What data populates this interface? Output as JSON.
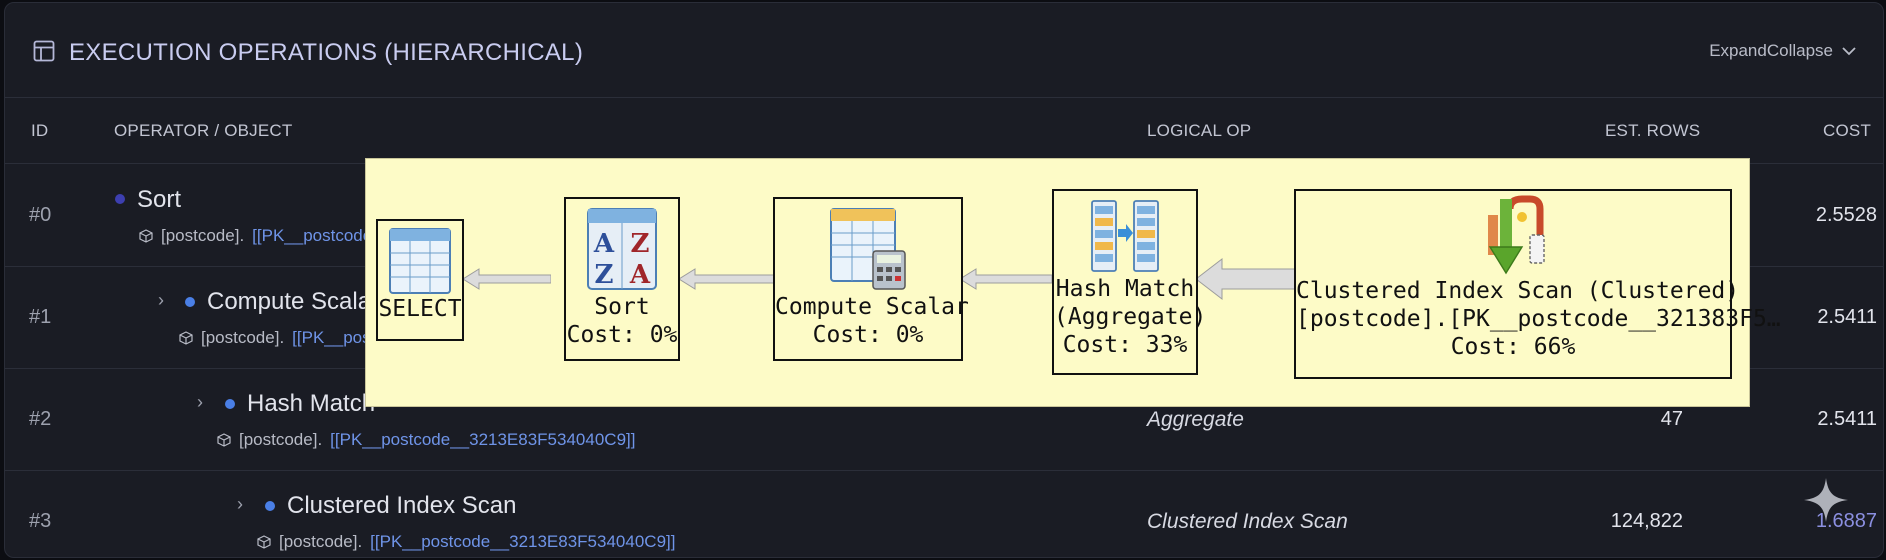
{
  "header": {
    "title": "EXECUTION OPERATIONS (HIERARCHICAL)",
    "toggle_label": "ExpandCollapse"
  },
  "columns": {
    "id": "ID",
    "operator": "OPERATOR / OBJECT",
    "logical": "LOGICAL OP",
    "rows": "EST. ROWS",
    "cost": "COST"
  },
  "rows": [
    {
      "id": "#0",
      "operator": "Sort",
      "object_prefix": "[postcode].",
      "object_link": "[[PK__postcode",
      "logical": "",
      "rows": "",
      "cost": "2.5528"
    },
    {
      "id": "#1",
      "operator": "Compute Scala",
      "object_prefix": "[postcode].",
      "object_link": "[[PK__post",
      "logical": "",
      "rows": "",
      "cost": "2.5411"
    },
    {
      "id": "#2",
      "operator": "Hash Match",
      "object_prefix": "[postcode].",
      "object_link": "[[PK__postcode__3213E83F534040C9]]",
      "logical": "Aggregate",
      "rows": "47",
      "cost": "2.5411"
    },
    {
      "id": "#3",
      "operator": "Clustered Index Scan",
      "object_prefix": "[postcode].",
      "object_link": "[[PK__postcode__3213E83F534040C9]]",
      "logical": "Clustered Index Scan",
      "rows": "124,822",
      "cost": "1.6887"
    }
  ],
  "plan": {
    "nodes": [
      {
        "lines": [
          "SELECT"
        ]
      },
      {
        "lines": [
          "Sort",
          "Cost: 0%"
        ]
      },
      {
        "lines": [
          "Compute Scalar",
          "Cost: 0%"
        ]
      },
      {
        "lines": [
          "Hash Match",
          "(Aggregate)",
          "Cost: 33%"
        ]
      },
      {
        "lines": [
          "Clustered Index Scan (Clustered)",
          "[postcode].[PK__postcode__321383F5…",
          "Cost: 66%"
        ]
      }
    ]
  },
  "colors": {
    "accent": "#6f94e8",
    "dot_dark": "#3d3fb0",
    "dot_blue": "#4a7fe6",
    "plan_bg": "#fdfbc7"
  }
}
